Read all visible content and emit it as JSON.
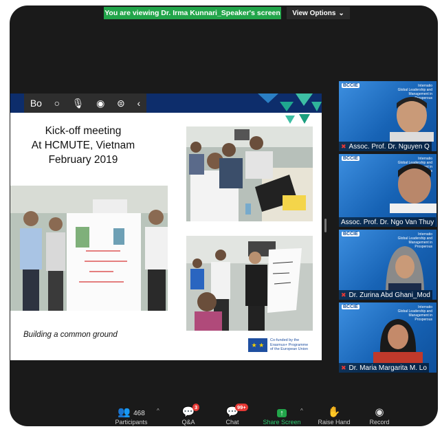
{
  "banner": {
    "text": "You are viewing Dr. Irma Kunnari_Speaker's screen"
  },
  "view_options": {
    "label": "View Options",
    "caret": "⌄"
  },
  "annotation_toolbar": {
    "items": [
      "Bo",
      "○",
      "🎙",
      "◉",
      "⊜",
      "‹"
    ]
  },
  "slide": {
    "title_lines": [
      "Kick-off meeting",
      "At HCMUTE, Vietnam",
      "February 2019"
    ],
    "caption": "Building a common ground",
    "eu_text": [
      "Co-funded by the",
      "Erasmus+ Programme",
      "of the European Union"
    ]
  },
  "tiles": [
    {
      "name": "Assoc. Prof. Dr. Nguyen Q",
      "active": false
    },
    {
      "name": "Assoc. Prof. Dr. Ngo Van Thuy",
      "active": true
    },
    {
      "name": "Dr. Zurina Abd Ghani_Mod",
      "active": false
    },
    {
      "name": "Dr. Maria Margarita M. Lo",
      "active": false
    }
  ],
  "tile_logo": {
    "badge": "BCCIE",
    "heading": [
      "Internatio",
      "Global Leadership and Management in",
      "Prosperous"
    ]
  },
  "toolbar": {
    "participants": {
      "label": "Participants",
      "count": "468"
    },
    "qa": {
      "label": "Q&A",
      "badge": "3"
    },
    "chat": {
      "label": "Chat",
      "badge": "99+"
    },
    "share": {
      "label": "Share Screen"
    },
    "raise": {
      "label": "Raise Hand"
    },
    "record": {
      "label": "Record"
    }
  },
  "colors": {
    "banner": "#22a54a",
    "slide_header": "#0d2d6b",
    "tile_blue": "#1f73c7",
    "active_border": "#d8f000",
    "badge_red": "#e53935"
  }
}
